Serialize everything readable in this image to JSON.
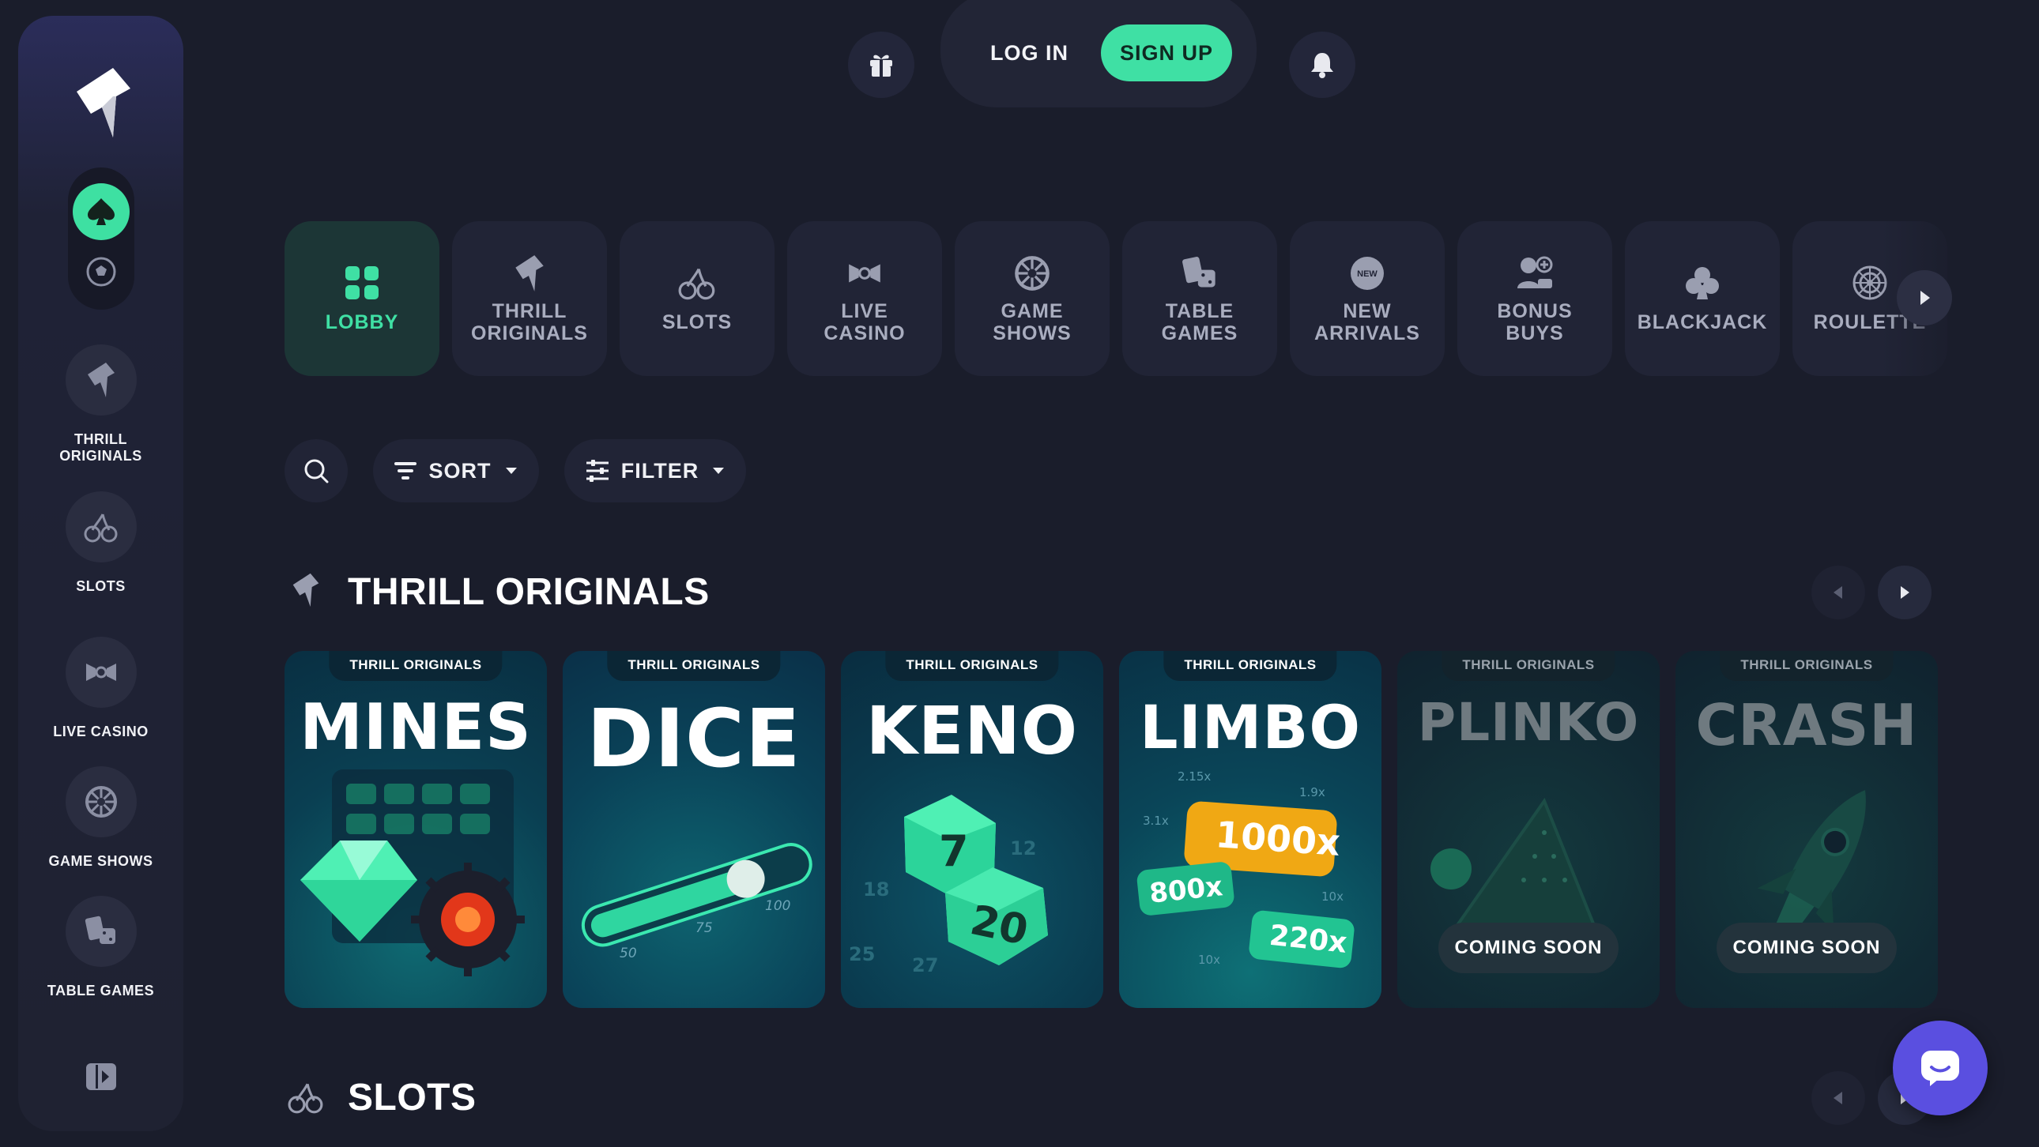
{
  "header": {
    "login_label": "LOG IN",
    "signup_label": "SIGN UP"
  },
  "sidebar": {
    "items": [
      {
        "label_line1": "THRILL",
        "label_line2": "ORIGINALS",
        "icon": "thrill-logo-icon"
      },
      {
        "label_line1": "SLOTS",
        "label_line2": "",
        "icon": "cherries-icon"
      },
      {
        "label_line1": "LIVE CASINO",
        "label_line2": "",
        "icon": "live-casino-icon"
      },
      {
        "label_line1": "GAME SHOWS",
        "label_line2": "",
        "icon": "wheel-icon"
      },
      {
        "label_line1": "TABLE GAMES",
        "label_line2": "",
        "icon": "cards-dice-icon"
      }
    ]
  },
  "categories": [
    {
      "line1": "LOBBY",
      "line2": "",
      "icon": "grid-icon",
      "active": true
    },
    {
      "line1": "THRILL",
      "line2": "ORIGINALS",
      "icon": "thrill-logo-icon"
    },
    {
      "line1": "SLOTS",
      "line2": "",
      "icon": "cherries-icon"
    },
    {
      "line1": "LIVE",
      "line2": "CASINO",
      "icon": "live-casino-icon"
    },
    {
      "line1": "GAME",
      "line2": "SHOWS",
      "icon": "wheel-icon"
    },
    {
      "line1": "TABLE",
      "line2": "GAMES",
      "icon": "cards-dice-icon"
    },
    {
      "line1": "NEW",
      "line2": "ARRIVALS",
      "icon": "new-badge-icon",
      "badge_text": "NEW"
    },
    {
      "line1": "BONUS",
      "line2": "BUYS",
      "icon": "bonus-user-icon"
    },
    {
      "line1": "BLACKJACK",
      "line2": "",
      "icon": "club-icon"
    },
    {
      "line1": "ROULETTE",
      "line2": "",
      "icon": "roulette-icon"
    }
  ],
  "toolbar": {
    "sort_label": "SORT",
    "filter_label": "FILTER"
  },
  "sections": {
    "originals_title": "THRILL ORIGINALS",
    "slots_title": "SLOTS"
  },
  "games": [
    {
      "tag": "THRILL ORIGINALS",
      "title": "MINES",
      "coming_soon": ""
    },
    {
      "tag": "THRILL ORIGINALS",
      "title": "DICE",
      "coming_soon": "",
      "art_numbers": [
        "50",
        "75",
        "100"
      ]
    },
    {
      "tag": "THRILL ORIGINALS",
      "title": "KENO",
      "coming_soon": "",
      "art_numbers": [
        "7",
        "20",
        "12",
        "18",
        "25",
        "27"
      ]
    },
    {
      "tag": "THRILL ORIGINALS",
      "title": "LIMBO",
      "coming_soon": "",
      "art_numbers": [
        "1000x",
        "800x",
        "220x",
        "2.15x",
        "1.9x",
        "3.1x",
        "10x",
        "10x"
      ]
    },
    {
      "tag": "THRILL ORIGINALS",
      "title": "PLINKO",
      "coming_soon": "COMING SOON"
    },
    {
      "tag": "THRILL ORIGINALS",
      "title": "CRASH",
      "coming_soon": "COMING SOON"
    }
  ],
  "colors": {
    "accent": "#3fe0a4",
    "background": "#1a1d2b",
    "panel": "#212436",
    "chat_button": "#5a4fe0"
  }
}
